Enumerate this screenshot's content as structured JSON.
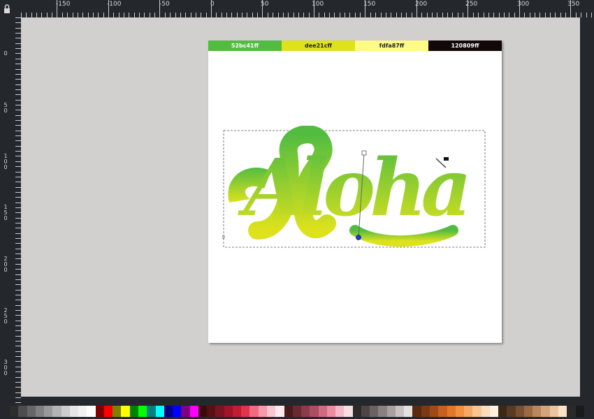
{
  "rulers": {
    "top_labels": [
      "-150",
      "-100",
      "-50",
      "0",
      "50",
      "100",
      "150",
      "200",
      "250",
      "300",
      "350"
    ],
    "left_labels": [
      "0",
      "50",
      "100",
      "150",
      "200",
      "250",
      "300"
    ]
  },
  "swatches": [
    {
      "label": "52bc41ff",
      "color": "#52bc41",
      "text": "#ffffff"
    },
    {
      "label": "dee21cff",
      "color": "#dee21c",
      "text": "#222222"
    },
    {
      "label": "fdfa87ff",
      "color": "#fdfa87",
      "text": "#222222"
    },
    {
      "label": "120809ff",
      "color": "#120809",
      "text": "#ffffff"
    }
  ],
  "artwork": {
    "text": "Aloha",
    "gradient_top": "#52bc41",
    "gradient_bottom": "#dee21c"
  },
  "palette": [
    "#2d2d2d",
    "#4d4d4d",
    "#666666",
    "#808080",
    "#999999",
    "#b3b3b3",
    "#cccccc",
    "#e6e6e6",
    "#f2f2f2",
    "#ffffff",
    "#800000",
    "#ff0000",
    "#808000",
    "#ffff00",
    "#008000",
    "#00ff00",
    "#008080",
    "#00ffff",
    "#000080",
    "#0000ff",
    "#800080",
    "#ff00ff",
    "#3a0b0b",
    "#5a0f14",
    "#7a1420",
    "#a0152a",
    "#c01d34",
    "#e0334c",
    "#f06a80",
    "#f49aa8",
    "#f8c6ce",
    "#ffe8ec",
    "#4a1a1a",
    "#6b2a33",
    "#8c3b4a",
    "#ad4d63",
    "#ce6a82",
    "#e88da2",
    "#f5b8c6",
    "#f8dde3",
    "#2e2a2a",
    "#4d4545",
    "#6b6161",
    "#8a8080",
    "#aaa0a0",
    "#cac2c2",
    "#e6e1e1",
    "#5a2a10",
    "#7a3a14",
    "#a04a18",
    "#c86020",
    "#e07828",
    "#f09040",
    "#f4aa66",
    "#f8c490",
    "#fbdcbc",
    "#fff0e0",
    "#3d2818",
    "#5a3a22",
    "#7a5030",
    "#9a6a44",
    "#ba865c",
    "#d6a47a",
    "#ecc49e",
    "#f8e2c8",
    "#2a2a2a",
    "#1a1a1a"
  ]
}
